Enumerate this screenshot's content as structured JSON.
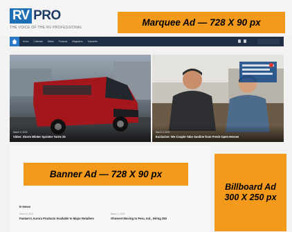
{
  "logo": {
    "rv": "RV",
    "pro": "PRO",
    "tagline": "THE VOICE OF THE RV PROFESSIONAL"
  },
  "ads": {
    "marquee": "Marquee Ad — 728 X 90 px",
    "banner": "Banner Ad — 728 X 90 px",
    "billboard_line1": "Billboard  Ad",
    "billboard_line2": "300 X 250 px"
  },
  "nav": {
    "items": [
      "Home",
      "Channels",
      "Media",
      "Products",
      "Magazines",
      "Subscribe"
    ]
  },
  "hero": [
    {
      "date": "March 3, 2023",
      "title": "Video: Storm Winter Sprinter Turns 25"
    },
    {
      "date": "March 3, 2023",
      "title": "Exclusive: We Couple Take Sunline from Fresh Open Heroes"
    }
  ],
  "news": {
    "section_title": "E-News",
    "items": [
      {
        "date": "March 3, 2023",
        "title": "Fantam's Aurora Products Available to Major Retailers"
      },
      {
        "date": "March 3, 2023",
        "title": "Ohmrest Moving to Peru, Ind., Hiring 250"
      }
    ]
  },
  "colors": {
    "ad_orange": "#f39a1d",
    "nav_bg": "#1f2e44",
    "brand_blue": "#1f6fb6"
  }
}
